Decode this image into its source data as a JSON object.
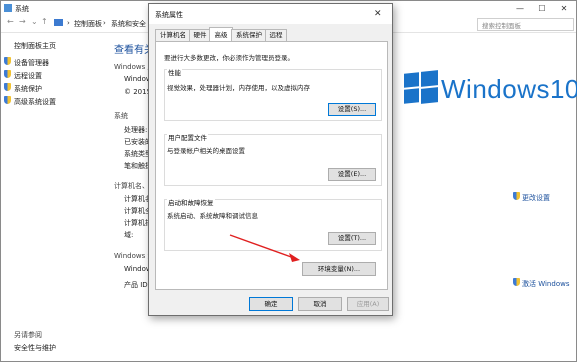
{
  "window": {
    "title": "系统",
    "controls": [
      "—",
      "☐",
      "✕"
    ]
  },
  "address": {
    "crumbs": [
      "控制面板",
      "系统和安全"
    ],
    "search_placeholder": "搜索控制面板"
  },
  "left_panel": {
    "home": "控制面板主页",
    "links": [
      "设备管理器",
      "远程设置",
      "系统保护",
      "高级系统设置"
    ],
    "see_also": "另请参阅",
    "see_also_link": "安全性与维护"
  },
  "main": {
    "heading": "查看有关",
    "windows_edition_label": "Windows 版",
    "windows_line": "Windows",
    "copyright": "© 2015 M",
    "system_label": "系统",
    "system_rows": [
      "处理器:",
      "已安装的",
      "系统类型",
      "笔和触摸"
    ],
    "computer_label": "计算机名、",
    "computer_rows": [
      "计算机名",
      "计算机全",
      "计算机描",
      "域:"
    ],
    "activation_label": "Windows 激",
    "activation_rows": [
      "Windows",
      "产品 ID:"
    ]
  },
  "right": {
    "logo_text": "Windows10",
    "change_settings": "更改设置",
    "activate": "激活 Windows"
  },
  "dialog": {
    "title": "系统属性",
    "tabs": [
      "计算机名",
      "硬件",
      "高级",
      "系统保护",
      "远程"
    ],
    "active_tab": "高级",
    "admin_note": "要进行大多数更改，你必须作为管理员登录。",
    "perf": {
      "title": "性能",
      "desc": "视觉效果，处理器计划，内存使用，以及虚拟内存",
      "button": "设置(S)..."
    },
    "profile": {
      "title": "用户配置文件",
      "desc": "与登录帐户相关的桌面设置",
      "button": "设置(E)..."
    },
    "startup": {
      "title": "启动和故障恢复",
      "desc": "系统启动、系统故障和调试信息",
      "button": "设置(T)..."
    },
    "env_button": "环境变量(N)...",
    "ok": "确定",
    "cancel": "取消",
    "apply": "应用(A)"
  },
  "colors": {
    "accent": "#0078d7",
    "logo": "#1a73c9",
    "arrow": "#e02020"
  }
}
